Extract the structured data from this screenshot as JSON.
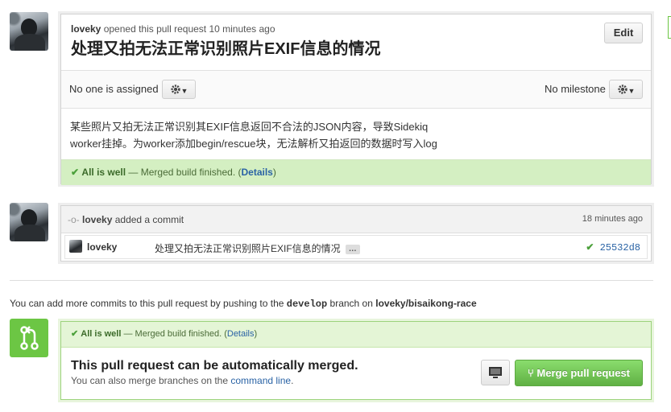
{
  "pr": {
    "author": "loveky",
    "opened_text": "opened this pull request 10 minutes ago",
    "title": "处理又拍无法正常识别照片EXIF信息的情况",
    "edit_label": "Edit",
    "assignee_text": "No one is assigned",
    "milestone_text": "No milestone",
    "description_line1": "某些照片又拍无法正常识别其EXIF信息返回不合法的JSON内容，导致Sidekiq",
    "description_line2": "worker挂掉。为worker添加begin/rescue块，无法解析又拍返回的数据时写入log",
    "status_ok": "All is well",
    "status_text": " — Merged build finished. (",
    "status_link": "Details",
    "status_close": ")"
  },
  "commit": {
    "author": "loveky",
    "action": "added a commit",
    "time": "18 minutes ago",
    "row_author": "loveky",
    "message": "处理又拍无法正常识别照片EXIF信息的情况",
    "ellipsis": "…",
    "sha": "25532d8"
  },
  "push_note": {
    "prefix": "You can add more commits to this pull request by pushing to the ",
    "branch": "develop",
    "middle": " branch on ",
    "repo": "loveky/bisaikong-race"
  },
  "merge": {
    "status_ok": "All is well",
    "status_text": " — Merged build finished. (",
    "status_link": "Details",
    "status_close": ")",
    "title": "This pull request can be automatically merged.",
    "sub_prefix": "You can also merge branches on the ",
    "sub_link": "command line",
    "sub_suffix": ".",
    "button_label": "Merge pull request"
  },
  "icons": {
    "gear": "gear-icon",
    "commit": "commit-icon",
    "check": "check-icon",
    "merge": "merge-icon",
    "screen": "desktop-icon"
  },
  "colors": {
    "success_bg": "#d4efc2",
    "merge_green": "#6cc644",
    "link": "#2a63a5"
  }
}
